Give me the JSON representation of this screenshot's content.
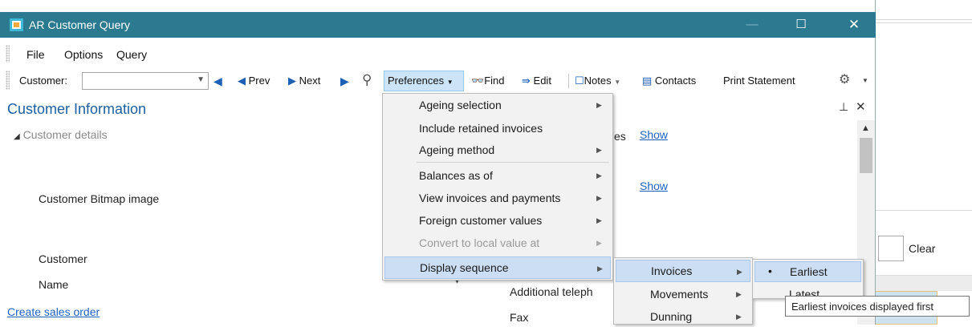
{
  "window": {
    "title": "AR Customer Query",
    "minimize": "—",
    "maximize": "☐",
    "close": "✕"
  },
  "menu": [
    "File",
    "Options",
    "Query"
  ],
  "toolbar": {
    "customer_label": "Customer:",
    "customer_value": "",
    "prev": "Prev",
    "next": "Next",
    "preferences": "Preferences",
    "find": "Find",
    "edit": "Edit",
    "notes": "Notes",
    "contacts": "Contacts",
    "print_statement": "Print Statement"
  },
  "panel": {
    "title": "Customer Information",
    "section": "Customer details",
    "bitmap_label": "Customer Bitmap image",
    "customer_label": "Customer",
    "name_label": "Name",
    "create_sales_order": "Create sales order",
    "right_fragment": "es",
    "show1": "Show",
    "show2": "Show",
    "additional_telephone": "Additional teleph",
    "fax": "Fax"
  },
  "background": {
    "clear": "Clear"
  },
  "preferences_menu": [
    {
      "label": "Ageing selection",
      "submenu": true,
      "disabled": false
    },
    {
      "label": "Include retained invoices",
      "submenu": false,
      "disabled": false
    },
    {
      "label": "Ageing method",
      "submenu": true,
      "disabled": false
    },
    {
      "label": "Balances as of",
      "submenu": true,
      "disabled": false
    },
    {
      "label": "View invoices and payments",
      "submenu": true,
      "disabled": false
    },
    {
      "label": "Foreign customer values",
      "submenu": true,
      "disabled": false
    },
    {
      "label": "Convert to local value at",
      "submenu": true,
      "disabled": true
    },
    {
      "label": "Display sequence",
      "submenu": true,
      "disabled": false,
      "highlighted": true
    }
  ],
  "display_sequence_menu": [
    {
      "label": "Invoices",
      "highlighted": true
    },
    {
      "label": "Movements"
    },
    {
      "label": "Dunning"
    }
  ],
  "invoices_menu": [
    {
      "label": "Earliest",
      "selected": true
    },
    {
      "label": "Latest"
    }
  ],
  "tooltip": "Earliest invoices displayed first",
  "colors": {
    "titlebar": "#2b7a90",
    "accent": "#1d5fa0",
    "link": "#1e63c2",
    "menu_highlight": "#ccdef4"
  }
}
